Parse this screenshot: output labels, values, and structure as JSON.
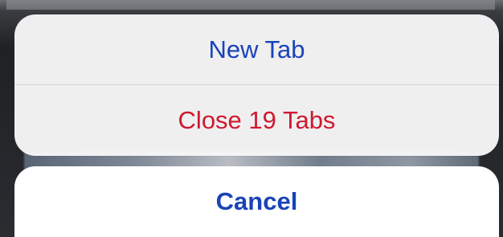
{
  "action_sheet": {
    "new_tab_label": "New Tab",
    "close_tabs_label": "Close 19 Tabs",
    "cancel_label": "Cancel"
  },
  "colors": {
    "accent_blue": "#1a43b8",
    "destructive_red": "#d0182f",
    "sheet_background": "#f6f6f7",
    "cancel_background": "#ffffff"
  }
}
